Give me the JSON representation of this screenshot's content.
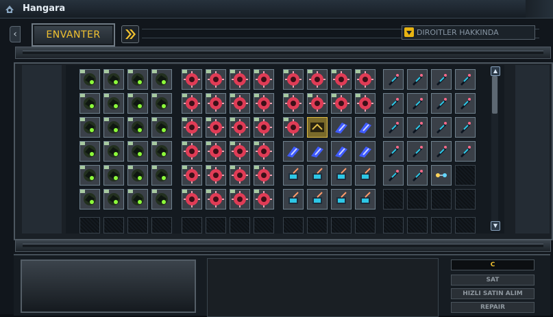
{
  "window": {
    "title": "Hangara"
  },
  "tabs": {
    "active_tab": "ENVANTER",
    "prev_glyph": "‹"
  },
  "dropdown": {
    "label": "DIROITLER HAKKINDA"
  },
  "actions": {
    "currency": "C",
    "sell": "SAT",
    "quick_buy": "HIZLI SATIN ALIM",
    "repair": "REPAIR"
  },
  "inventory": {
    "groups": [
      {
        "item": "green-drone",
        "rows": [
          4,
          4,
          4,
          4,
          4,
          4
        ],
        "empty_last_row": 4
      },
      {
        "item": "red-mine",
        "rows": [
          4,
          4,
          4,
          4,
          4,
          4
        ],
        "empty_last_row": 4
      },
      {
        "item": "mixed",
        "rows": [
          4,
          4,
          4,
          4,
          4,
          4
        ],
        "empty_last_row": 4
      },
      {
        "item": "ship-part",
        "rows": [
          4,
          4,
          4,
          4,
          3,
          0
        ],
        "empty_last_row": 4
      }
    ],
    "colors": {
      "green": "#8dff3a",
      "red": "#e03c56",
      "blue": "#3f5bff",
      "cyan": "#2dc7e6",
      "gold": "#e2c04a"
    }
  }
}
